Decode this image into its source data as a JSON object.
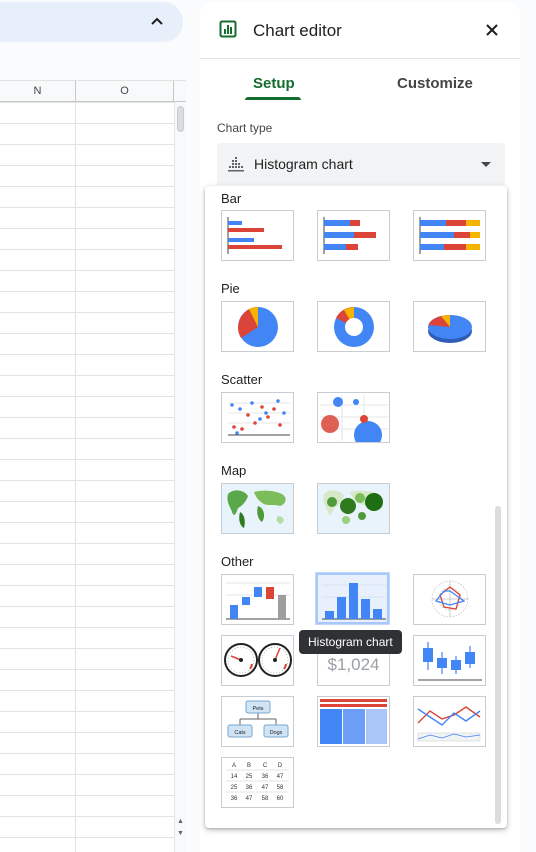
{
  "sheet": {
    "columns": [
      "N",
      "O"
    ]
  },
  "editor": {
    "title": "Chart editor",
    "tabs": [
      {
        "label": "Setup",
        "active": true
      },
      {
        "label": "Customize",
        "active": false
      }
    ],
    "chart_type_label": "Chart type",
    "selected_chart_type": "Histogram chart"
  },
  "dropdown": {
    "sections": [
      {
        "label": "Bar",
        "items": [
          "bar-chart",
          "stacked-bar-chart",
          "100-stacked-bar-chart"
        ]
      },
      {
        "label": "Pie",
        "items": [
          "pie-chart",
          "donut-chart",
          "3d-pie-chart"
        ]
      },
      {
        "label": "Scatter",
        "items": [
          "scatter-chart",
          "bubble-chart"
        ]
      },
      {
        "label": "Map",
        "items": [
          "geo-chart",
          "geo-chart-with-markers"
        ]
      },
      {
        "label": "Other",
        "items": [
          "waterfall-chart",
          "histogram-chart",
          "radar-chart",
          "gauge-chart",
          "scorecard-chart",
          "candlestick-chart",
          "organizational-chart",
          "treemap-chart",
          "timeline-chart",
          "table-chart"
        ]
      }
    ],
    "scorecard_value": "$1,024",
    "org_nodes": {
      "root": "Pets",
      "left": "Cats",
      "right": "Dogs"
    },
    "table_chart": {
      "headers": [
        "A",
        "B",
        "C",
        "D"
      ],
      "rows": [
        [
          "14",
          "25",
          "36",
          "47"
        ],
        [
          "25",
          "36",
          "47",
          "58"
        ],
        [
          "36",
          "47",
          "58",
          "60"
        ]
      ]
    },
    "tooltip": "Histogram chart"
  },
  "colors": {
    "blue": "#4285f4",
    "red": "#db4437",
    "yellow": "#f4b400",
    "green": "#0f9d58",
    "accent": "#146c2e"
  }
}
